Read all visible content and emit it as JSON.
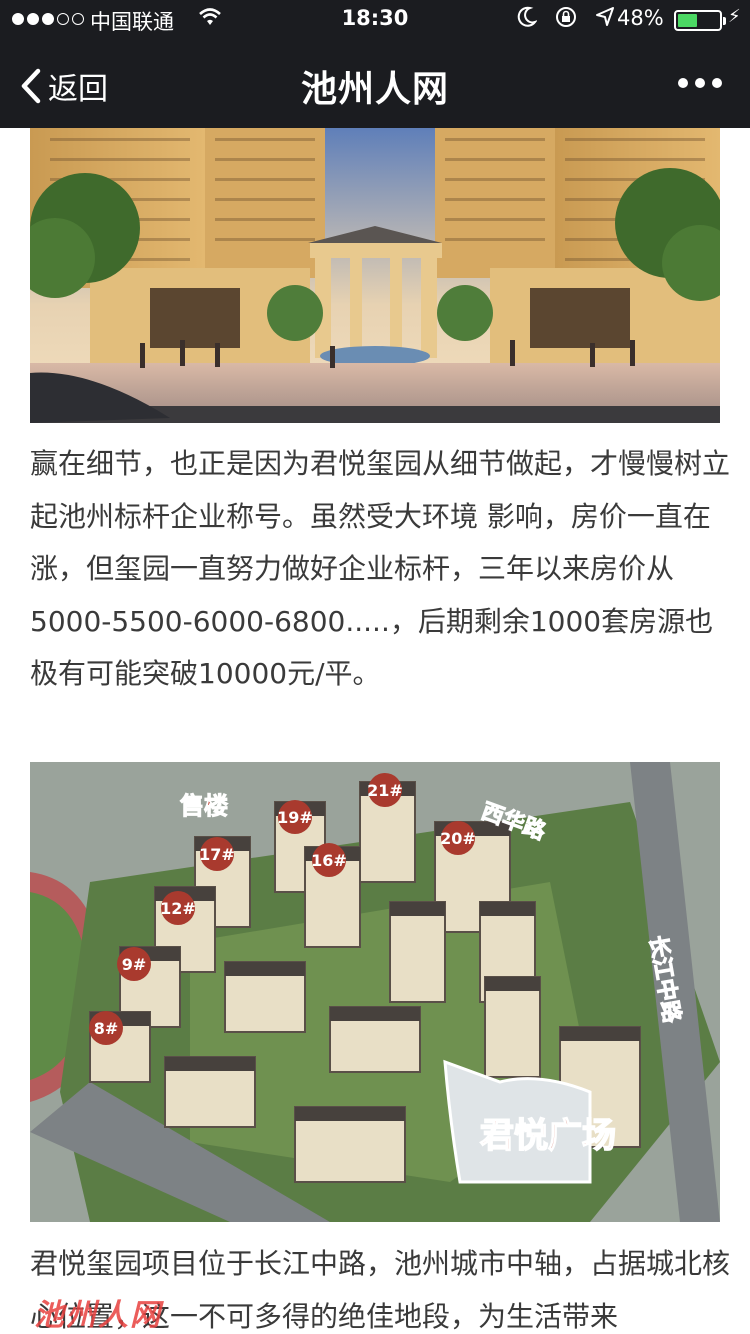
{
  "status": {
    "carrier": "中国联通",
    "time": "18:30",
    "battery_percent": "48%",
    "battery_level": 0.48,
    "signal_bars_filled": 3,
    "signal_bars_total": 5,
    "icons": [
      "moon-icon",
      "rotation-lock-icon",
      "location-icon",
      "battery-icon",
      "charging-icon"
    ],
    "battery_color": "#4cd964"
  },
  "nav": {
    "back_label": "返回",
    "title": "池州人网",
    "more_icon": "ellipsis-icon"
  },
  "article": {
    "paragraph1": "赢在细节，也正是因为君悦玺园从细节做起，才慢慢树立起池州标杆企业称号。虽然受大环境 影响，房价一直在涨，但玺园一直努力做好企业标杆，三年以来房价从5000-5500-6000-6800.....，后期剩余1000套房源也极有可能突破10000元/平。",
    "paragraph2": "君悦玺园项目位于长江中路，池州城市中轴，占据城北核心位置，这一不可多得的绝佳地段，为生活带来",
    "image2_labels": {
      "sales": "售楼",
      "buildings": [
        "21#",
        "19#",
        "17#",
        "16#",
        "20#",
        "12#",
        "9#",
        "8#"
      ],
      "road_top": "西华路",
      "road_right": "长江中路",
      "plaza": "君悦广场"
    },
    "watermark": "池州人网"
  }
}
